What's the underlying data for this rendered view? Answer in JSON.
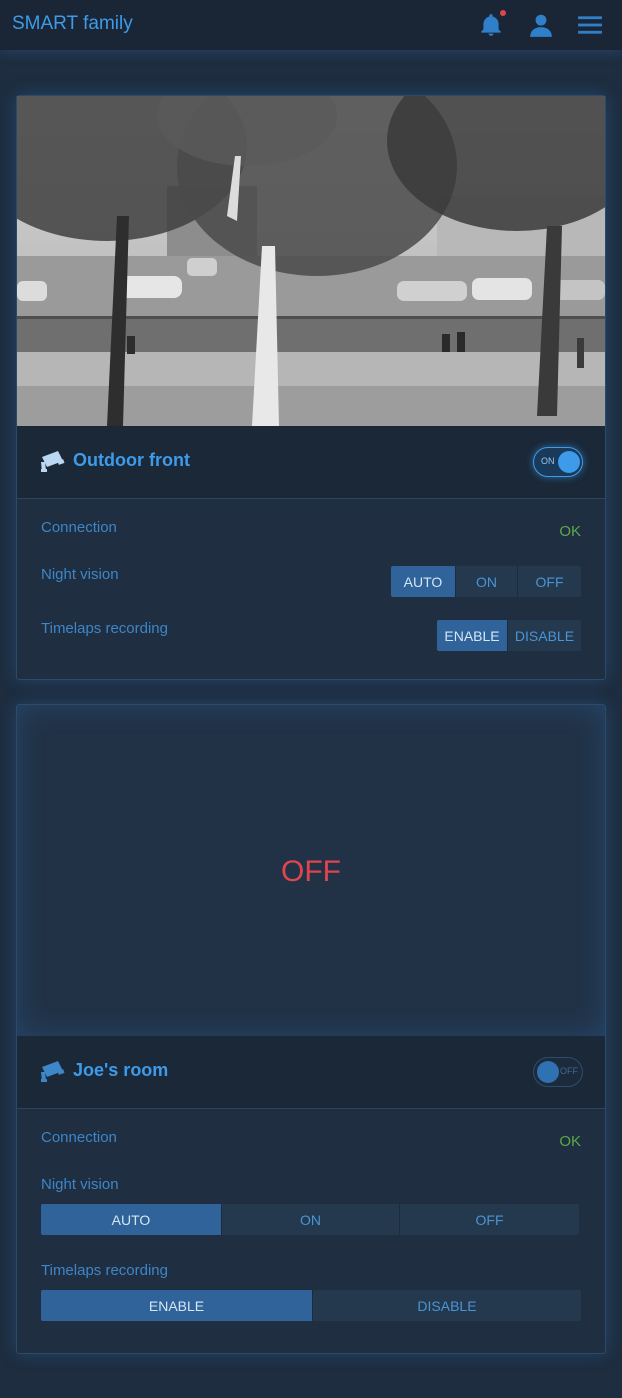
{
  "app": {
    "title": "SMART family"
  },
  "header": {
    "icons": {
      "bell": "bell-icon",
      "user": "user-icon",
      "menu": "hamburger-menu-icon"
    },
    "notification_dot_color": "#e0454f"
  },
  "colors": {
    "accent": "#3d9be9",
    "ok": "#5aa94a",
    "off": "#e0454f",
    "background": "#1e2d3f"
  },
  "cameras": [
    {
      "name": "Outdoor front",
      "icon": "security-camera-icon",
      "power": {
        "state": "on",
        "label": "ON"
      },
      "connection": {
        "label": "Connection",
        "value": "OK"
      },
      "night_vision": {
        "label": "Night vision",
        "options": [
          "AUTO",
          "ON",
          "OFF"
        ],
        "selected": "AUTO"
      },
      "timelapse": {
        "label": "Timelaps recording",
        "options": [
          "ENABLE",
          "DISABLE"
        ],
        "selected": "ENABLE"
      }
    },
    {
      "name": "Joe's room",
      "icon": "security-camera-icon",
      "power": {
        "state": "off",
        "label": "OFF"
      },
      "feed_off_label": "OFF",
      "connection": {
        "label": "Connection",
        "value": "OK"
      },
      "night_vision": {
        "label": "Night vision",
        "options": [
          "AUTO",
          "ON",
          "OFF"
        ],
        "selected": "AUTO"
      },
      "timelapse": {
        "label": "Timelaps recording",
        "options": [
          "ENABLE",
          "DISABLE"
        ],
        "selected": "ENABLE"
      }
    }
  ]
}
